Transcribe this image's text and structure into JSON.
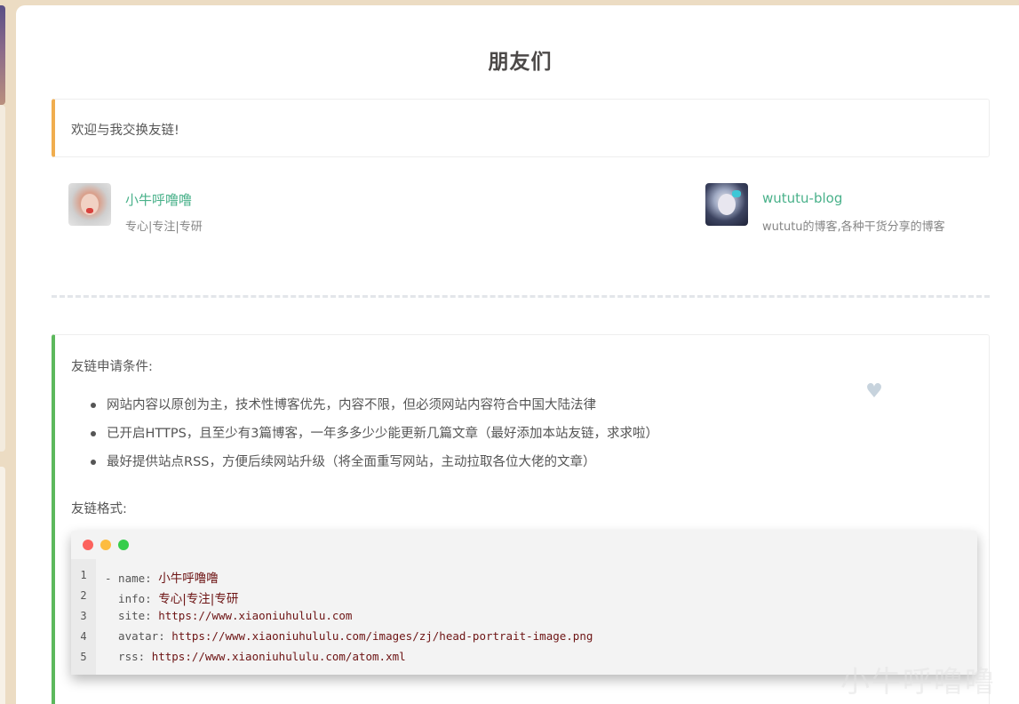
{
  "page_title": "朋友们",
  "welcome_note": "欢迎与我交换友链!",
  "friends": [
    {
      "name": "小牛呼噜噜",
      "desc": "专心|专注|专研",
      "avatar_icon": "portrait-avatar"
    },
    {
      "name": "wututu-blog",
      "desc": "wututu的博客,各种干货分享的博客",
      "avatar_icon": "anime-girl-avatar"
    }
  ],
  "apply": {
    "conditions_heading": "友链申请条件:",
    "conditions": [
      "网站内容以原创为主，技术性博客优先，内容不限，但必须网站内容符合中国大陆法律",
      "已开启HTTPS，且至少有3篇博客，一年多多少少能更新几篇文章（最好添加本站友链，求求啦）",
      "最好提供站点RSS，方便后续网站升级（将全面重写网站，主动拉取各位大佬的文章）"
    ],
    "format_heading": "友链格式:",
    "heart_icon": "heart-icon"
  },
  "code": {
    "lines": [
      {
        "num": "1",
        "key": "- name: ",
        "value": "小牛呼噜噜"
      },
      {
        "num": "2",
        "key": "  info: ",
        "value": "专心|专注|专研"
      },
      {
        "num": "3",
        "key": "  site: ",
        "value": "https://www.xiaoniuhululu.com"
      },
      {
        "num": "4",
        "key": "  avatar: ",
        "value": "https://www.xiaoniuhululu.com/images/zj/head-portrait-image.png"
      },
      {
        "num": "5",
        "key": "  rss: ",
        "value": "https://www.xiaoniuhululu.com/atom.xml"
      }
    ]
  },
  "watermark": "小牛呼噜噜",
  "colors": {
    "welcome_border": "#f0ad4e",
    "apply_border": "#5cb85c",
    "friend_link": "#49b18a"
  }
}
